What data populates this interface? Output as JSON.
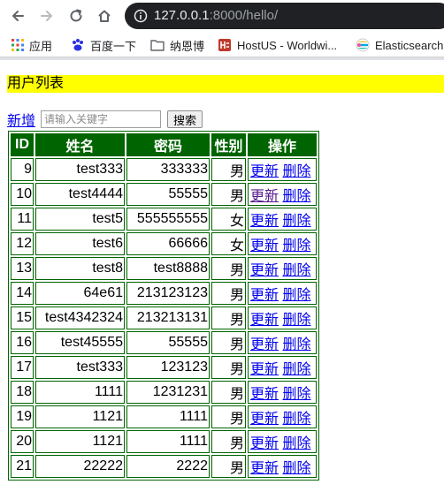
{
  "browser": {
    "url_host": "127.0.0.1",
    "url_rest": ":8000/hello/",
    "bookmarks": [
      {
        "label": "应用",
        "icon": "apps-grid-icon"
      },
      {
        "label": "百度一下",
        "icon": "baidu-paw-icon"
      },
      {
        "label": "纳恩博",
        "icon": "folder-icon"
      },
      {
        "label": "HostUS - Worldwi...",
        "icon": "hostus-icon"
      },
      {
        "label": "Elasticsearch",
        "icon": "elasticsearch-icon"
      }
    ]
  },
  "page": {
    "title": "用户列表",
    "add_label": "新增",
    "search_placeholder": "请输入关键字",
    "search_button": "搜索",
    "columns": [
      "ID",
      "姓名",
      "密码",
      "性别",
      "操作"
    ],
    "update_label": "更新",
    "delete_label": "删除",
    "rows": [
      {
        "id": "9",
        "name": "test333",
        "password": "333333",
        "sex": "男"
      },
      {
        "id": "10",
        "name": "test4444",
        "password": "55555",
        "sex": "男"
      },
      {
        "id": "11",
        "name": "test5",
        "password": "555555555",
        "sex": "女"
      },
      {
        "id": "12",
        "name": "test6",
        "password": "66666",
        "sex": "女"
      },
      {
        "id": "13",
        "name": "test8",
        "password": "test8888",
        "sex": "男"
      },
      {
        "id": "14",
        "name": "64e61",
        "password": "213123123",
        "sex": "男"
      },
      {
        "id": "15",
        "name": "test4342324",
        "password": "213213131",
        "sex": "男"
      },
      {
        "id": "16",
        "name": "test45555",
        "password": "55555",
        "sex": "男"
      },
      {
        "id": "17",
        "name": "test333",
        "password": "123123",
        "sex": "男"
      },
      {
        "id": "18",
        "name": "1111",
        "password": "1231231",
        "sex": "男"
      },
      {
        "id": "19",
        "name": "1121",
        "password": "1111",
        "sex": "男"
      },
      {
        "id": "20",
        "name": "1121",
        "password": "1111",
        "sex": "男"
      },
      {
        "id": "21",
        "name": "22222",
        "password": "2222",
        "sex": "男"
      }
    ],
    "visited_update_row": "10"
  }
}
